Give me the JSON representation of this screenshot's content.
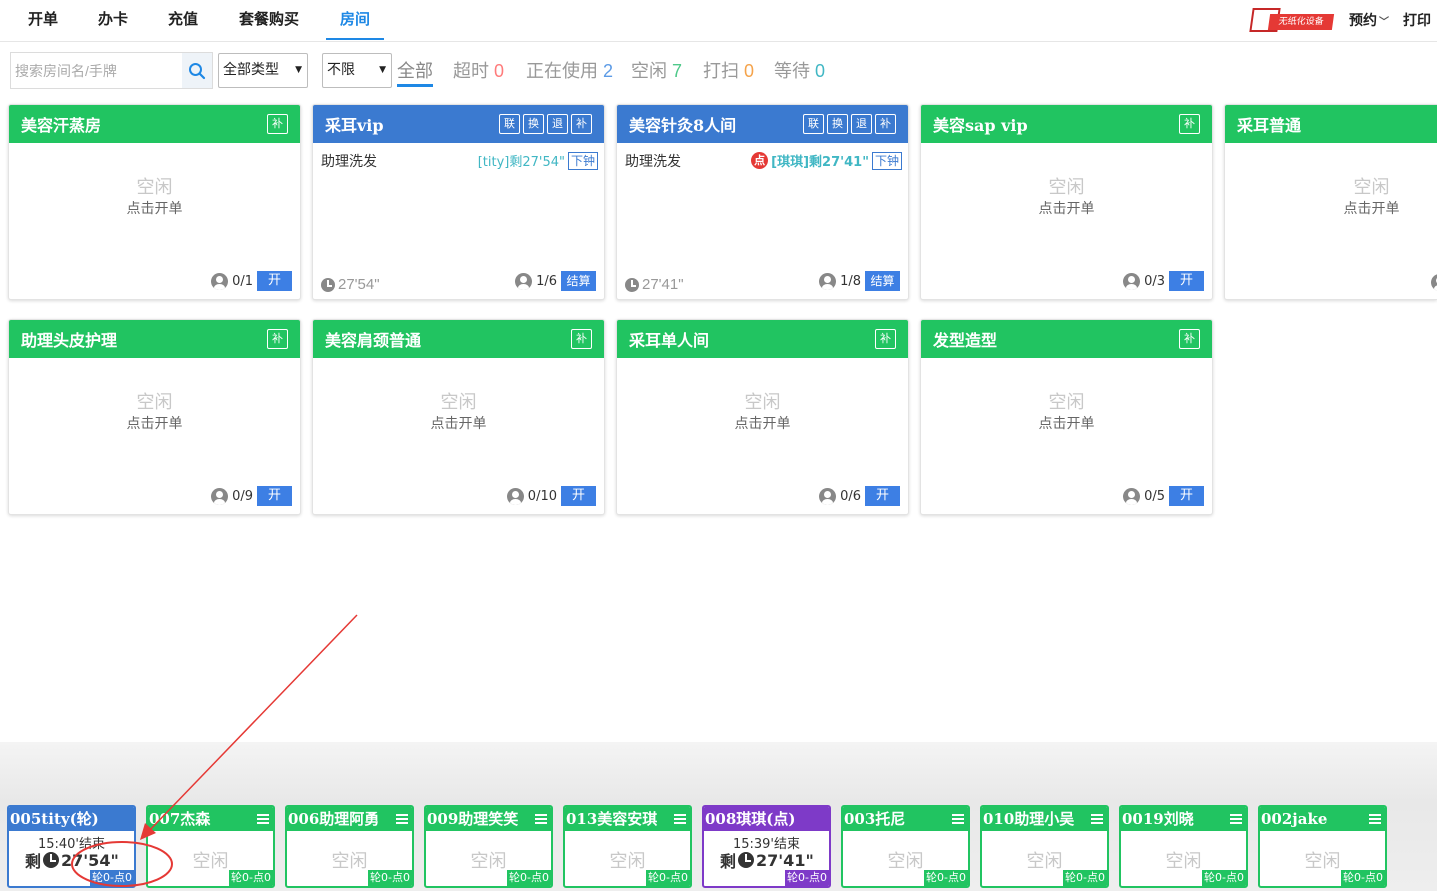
{
  "nav": {
    "items": [
      "开单",
      "办卡",
      "充值",
      "套餐购买",
      "房间"
    ],
    "active_index": 4
  },
  "top_right": {
    "device_label": "无纸化设备",
    "reserve_label": "预约",
    "print_label": "打印"
  },
  "filters": {
    "search_placeholder": "搜索房间名/手牌",
    "type_select": "全部类型",
    "limit_select": "不限",
    "statuses": [
      {
        "label": "全部",
        "count": ""
      },
      {
        "label": "超时",
        "count": "0"
      },
      {
        "label": "正在使用",
        "count": "2"
      },
      {
        "label": "空闲",
        "count": "7"
      },
      {
        "label": "打扫",
        "count": "0"
      },
      {
        "label": "等待",
        "count": "0"
      }
    ]
  },
  "rooms": [
    {
      "name": "美容汗蒸房",
      "status": "idle",
      "idle_text": "空闲",
      "hint": "点击开单",
      "occupancy": "0/1",
      "action": "开",
      "buttons": [
        "补"
      ]
    },
    {
      "name": "采耳vip",
      "status": "busy",
      "service": "助理洗发",
      "svc_status": "[tity]剩27'54\"",
      "clock_label": "下钟",
      "timer": "27'54\"",
      "occupancy": "1/6",
      "action": "结算",
      "buttons": [
        "联",
        "换",
        "退",
        "补"
      ]
    },
    {
      "name": "美容针灸8人间",
      "status": "busy",
      "service": "助理洗发",
      "dot_label": "点",
      "svc_status": "[琪琪]剩27'41\"",
      "clock_label": "下钟",
      "timer": "27'41\"",
      "occupancy": "1/8",
      "action": "结算",
      "buttons": [
        "联",
        "换",
        "退",
        "补"
      ]
    },
    {
      "name": "美容sap vip",
      "status": "idle",
      "idle_text": "空闲",
      "hint": "点击开单",
      "occupancy": "0/3",
      "action": "开",
      "buttons": [
        "补"
      ]
    },
    {
      "name": "采耳普通",
      "status": "idle",
      "idle_text": "空闲",
      "hint": "点击开单",
      "occupancy": "",
      "action": "",
      "buttons": []
    },
    {
      "name": "助理头皮护理",
      "status": "idle",
      "idle_text": "空闲",
      "hint": "点击开单",
      "occupancy": "0/9",
      "action": "开",
      "buttons": [
        "补"
      ]
    },
    {
      "name": "美容肩颈普通",
      "status": "idle",
      "idle_text": "空闲",
      "hint": "点击开单",
      "occupancy": "0/10",
      "action": "开",
      "buttons": [
        "补"
      ]
    },
    {
      "name": "采耳单人间",
      "status": "idle",
      "idle_text": "空闲",
      "hint": "点击开单",
      "occupancy": "0/6",
      "action": "开",
      "buttons": [
        "补"
      ]
    },
    {
      "name": "发型造型",
      "status": "idle",
      "idle_text": "空闲",
      "hint": "点击开单",
      "occupancy": "0/5",
      "action": "开",
      "buttons": [
        "补"
      ]
    }
  ],
  "technicians": [
    {
      "name": "005tity(轮)",
      "color": "blue",
      "busy": true,
      "end_time": "15:40'结束",
      "remain_prefix": "剩",
      "remain": "27'54\"",
      "badge": "轮0-点0"
    },
    {
      "name": "007杰森",
      "color": "green",
      "busy": false,
      "idle_text": "空闲",
      "badge": "轮0-点0"
    },
    {
      "name": "006助理阿勇",
      "color": "green",
      "busy": false,
      "idle_text": "空闲",
      "badge": "轮0-点0"
    },
    {
      "name": "009助理笑笑",
      "color": "green",
      "busy": false,
      "idle_text": "空闲",
      "badge": "轮0-点0"
    },
    {
      "name": "013美容安琪",
      "color": "green",
      "busy": false,
      "idle_text": "空闲",
      "badge": "轮0-点0"
    },
    {
      "name": "008琪琪(点)",
      "color": "purple",
      "busy": true,
      "end_time": "15:39'结束",
      "remain_prefix": "剩",
      "remain": "27'41\"",
      "badge": "轮0-点0"
    },
    {
      "name": "003托尼",
      "color": "green",
      "busy": false,
      "idle_text": "空闲",
      "badge": "轮0-点0"
    },
    {
      "name": "010助理小吴",
      "color": "green",
      "busy": false,
      "idle_text": "空闲",
      "badge": "轮0-点0"
    },
    {
      "name": "0019刘晓",
      "color": "green",
      "busy": false,
      "idle_text": "空闲",
      "badge": "轮0-点0"
    },
    {
      "name": "002jake",
      "color": "green",
      "busy": false,
      "idle_text": "空闲",
      "badge": "轮0-点0"
    }
  ],
  "colors": {
    "green": "#21c461",
    "blue": "#3b7ad0",
    "purple": "#7e3ac8",
    "accent": "#1e88e5",
    "annotation": "#e53935"
  }
}
